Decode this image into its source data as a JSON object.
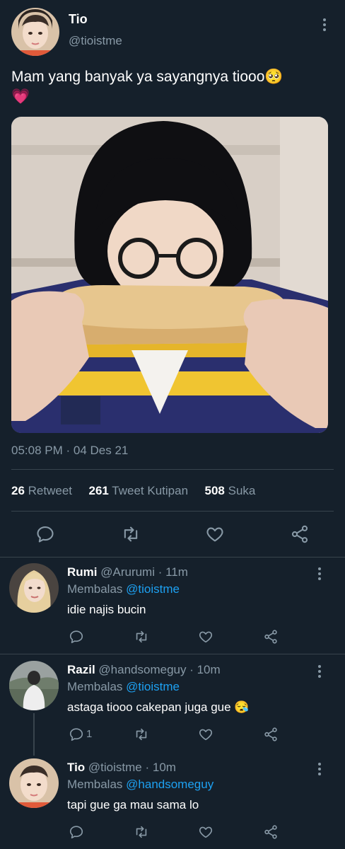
{
  "tweet": {
    "author": {
      "name": "Tio",
      "handle": "@tioistme"
    },
    "text": "Mam yang banyak ya sayangnya tiooo🥺",
    "text2": "💗",
    "timestamp": "05:08 PM · 04 Des 21",
    "stats": {
      "retweets": "26",
      "retweets_label": "Retweet",
      "quotes": "261",
      "quotes_label": "Tweet Kutipan",
      "likes": "508",
      "likes_label": "Suka"
    }
  },
  "replies": [
    {
      "name": "Rumi",
      "handle": "@Arurumi",
      "time": "· 11m",
      "replying_label": "Membalas",
      "replying_to": "@tioistme",
      "text": "idie najis bucin",
      "reply_count": ""
    },
    {
      "name": "Razil",
      "handle": "@handsomeguy",
      "time": "· 10m",
      "replying_label": "Membalas",
      "replying_to": "@tioistme",
      "text": "astaga tiooo cakepan juga gue 😪",
      "reply_count": "1"
    },
    {
      "name": "Tio",
      "handle": "@tioistme",
      "time": "· 10m",
      "replying_label": "Membalas",
      "replying_to": "@handsomeguy",
      "text": "tapi gue ga mau sama lo",
      "reply_count": ""
    }
  ],
  "colors": {
    "background": "#15202b",
    "muted": "#8899a6",
    "link": "#1da1f2",
    "divider": "#38444d"
  }
}
